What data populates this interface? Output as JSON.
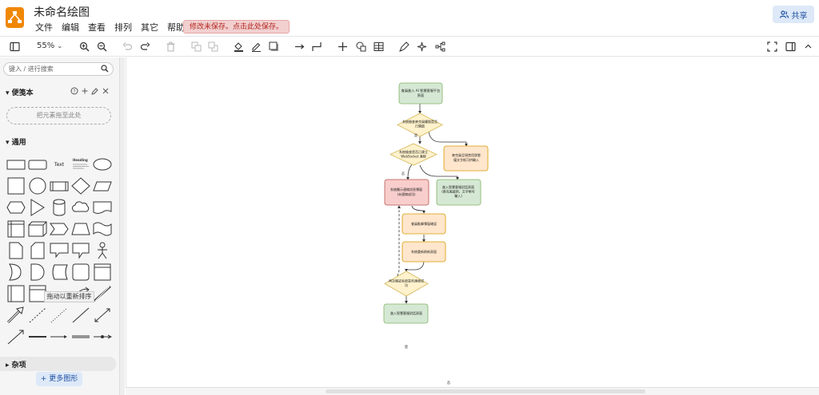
{
  "header": {
    "title": "未命名绘图",
    "menu": [
      "文件",
      "编辑",
      "查看",
      "排列",
      "其它",
      "帮助"
    ],
    "unsaved_notice": "修改未保存。点击此处保存。",
    "share_label": "共享"
  },
  "toolbar": {
    "zoom": "55%"
  },
  "sidebar": {
    "search_placeholder": "键入 / 进行搜索",
    "scratchpad_title": "便笺本",
    "scratchpad_drop": "把元素拖至此处",
    "general_title": "通用",
    "text_shape_label": "Text",
    "heading_shape_label": "Heading",
    "tooltip": "拖动以重新排序",
    "misc_title": "杂项",
    "more_shapes": "更多图形"
  },
  "diagram": {
    "nodes": {
      "n1": [
        "會員進入 AI 智慧客服平台",
        "頁面"
      ],
      "n2": [
        "系統檢查麥克風權限是否",
        "已開啟"
      ],
      "n3": [
        "系統檢查是否已建立",
        "WebSocket 連線"
      ],
      "n4": [
        "麥克風呈現禁用狀態",
        "僅文字框可供輸入"
      ],
      "n5": [
        "系統顯示連線訊息彈窗",
        "(未連線成功)"
      ],
      "n6": [
        "進入智慧客服對話頁面",
        "(麥克風啟用、文字框可",
        "輸入)"
      ],
      "n7": [
        "會員點擊彈窗確認"
      ],
      "n8": [
        "系統重新刷新頁面"
      ],
      "n9": [
        "再次確認系統是否連線成",
        "功"
      ],
      "n10": [
        "進入智慧客服對話頁面"
      ]
    },
    "edge_labels": {
      "yes": "是",
      "no": "否"
    }
  },
  "colors": {
    "accent": "#f08705",
    "green_fill": "#d5e8d4",
    "green_stroke": "#82b366",
    "yellow_fill": "#fff2cc",
    "yellow_stroke": "#d6b656",
    "orange_fill": "#ffe6cc",
    "orange_stroke": "#d79b00",
    "red_fill": "#f8cecc",
    "red_stroke": "#b85450"
  }
}
